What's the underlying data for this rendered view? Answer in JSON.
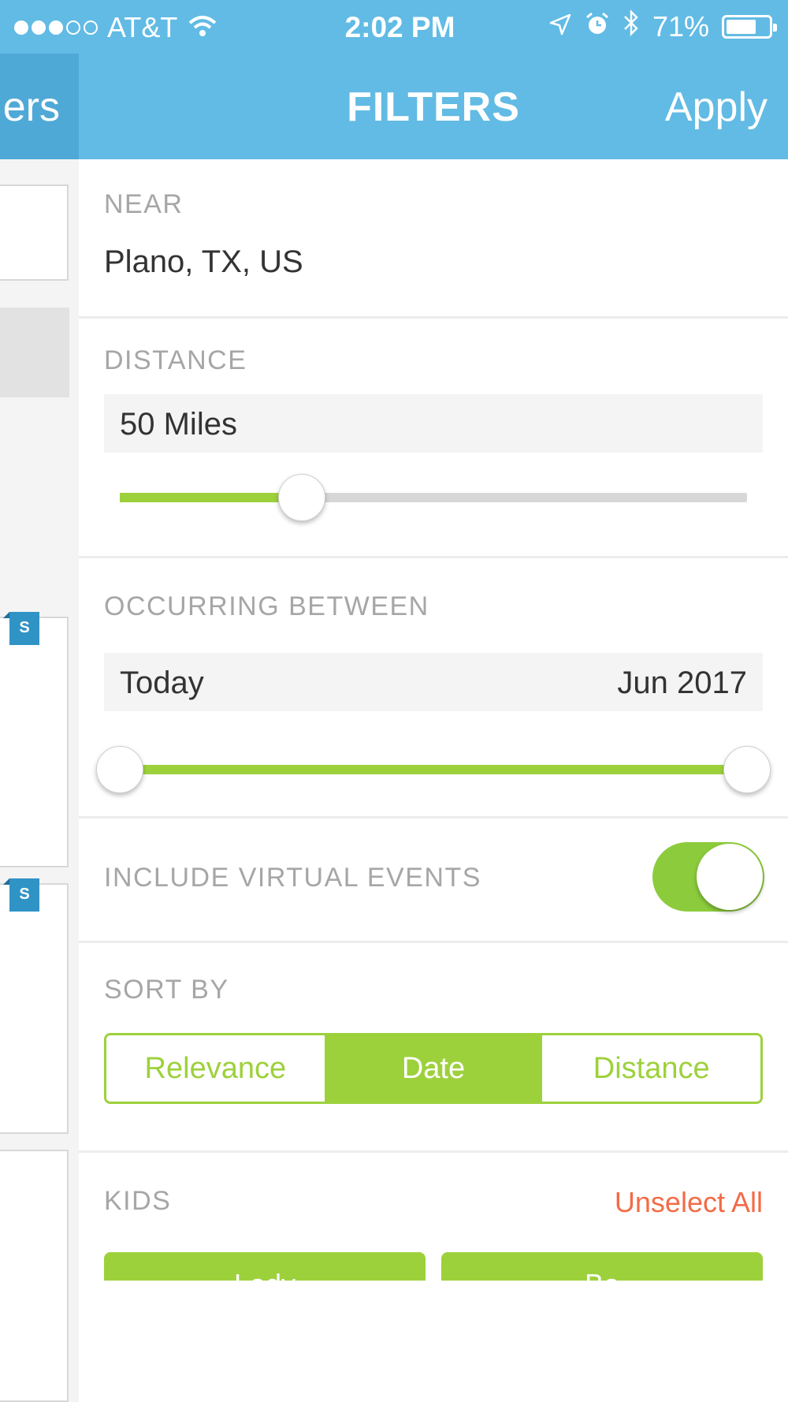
{
  "status_bar": {
    "carrier": "AT&T",
    "time": "2:02 PM",
    "battery": "71%",
    "battery_level": 0.71,
    "icons": [
      "wifi-icon",
      "location-icon",
      "alarm-icon",
      "bluetooth-icon",
      "battery-icon"
    ]
  },
  "nav": {
    "back_label": "ers",
    "title": "FILTERS",
    "apply_label": "Apply"
  },
  "background_list": {
    "badges": [
      "S",
      "S"
    ]
  },
  "filters": {
    "near": {
      "label": "NEAR",
      "value": "Plano, TX, US"
    },
    "distance": {
      "label": "DISTANCE",
      "value": "50 Miles",
      "slider_fraction": 0.29
    },
    "occurring": {
      "label": "OCCURRING BETWEEN",
      "from": "Today",
      "to": "Jun 2017",
      "range_fraction": [
        0,
        1
      ]
    },
    "virtual": {
      "label": "INCLUDE VIRTUAL EVENTS",
      "enabled": true
    },
    "sort": {
      "label": "SORT BY",
      "options": [
        "Relevance",
        "Date",
        "Distance"
      ],
      "selected": "Date"
    },
    "kids": {
      "label": "KIDS",
      "unselect_label": "Unselect All",
      "chips": [
        "Lady",
        "Bo"
      ]
    }
  },
  "colors": {
    "header": "#62bbe4",
    "accent_green": "#9dd13c",
    "unselect_orange": "#f26b47",
    "badge_blue": "#2f93c6"
  }
}
